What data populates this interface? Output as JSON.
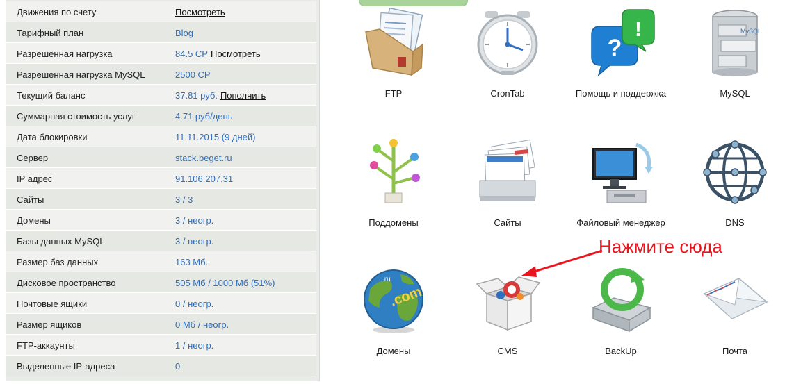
{
  "account": {
    "rows": [
      {
        "label": "Движения по счету",
        "value": "",
        "link": "Посмотреть"
      },
      {
        "label": "Тарифный план",
        "value": "Blog",
        "value_underlined": true,
        "link": ""
      },
      {
        "label": "Разрешенная нагрузка",
        "value": "84.5 CP",
        "link": "Посмотреть"
      },
      {
        "label": "Разрешенная нагрузка MySQL",
        "value": "2500 CP",
        "link": ""
      },
      {
        "label": "Текущий баланс",
        "value": "37.81 руб.",
        "link": "Пополнить"
      },
      {
        "label": "Суммарная стоимость услуг",
        "value": "4.71 руб/день",
        "link": ""
      },
      {
        "label": "Дата блокировки",
        "value": "11.11.2015 (9 дней)",
        "link": ""
      },
      {
        "label": "Сервер",
        "value": "stack.beget.ru",
        "link": ""
      },
      {
        "label": "IP адрес",
        "value": "91.106.207.31",
        "link": ""
      },
      {
        "label": "Сайты",
        "value": "3 / 3",
        "link": ""
      },
      {
        "label": "Домены",
        "value": "3 / неогр.",
        "link": ""
      },
      {
        "label": "Базы данных MySQL",
        "value": "3 / неогр.",
        "link": ""
      },
      {
        "label": "Размер баз данных",
        "value": "163 Мб.",
        "link": ""
      },
      {
        "label": "Дисковое пространство",
        "value": "505 Мб / 1000 Мб (51%)",
        "link": ""
      },
      {
        "label": "Почтовые ящики",
        "value": "0 / неогр.",
        "link": ""
      },
      {
        "label": "Размер ящиков",
        "value": "0 Мб / неогр.",
        "link": ""
      },
      {
        "label": "FTP-аккаунты",
        "value": "1 / неогр.",
        "link": ""
      },
      {
        "label": "Выделенные IP-адреса",
        "value": "0",
        "link": ""
      }
    ]
  },
  "tools": {
    "ftp": {
      "label": "FTP",
      "icon": "folder-documents-icon"
    },
    "crontab": {
      "label": "CronTab",
      "icon": "alarm-clock-icon"
    },
    "help": {
      "label": "Помощь и поддержка",
      "icon": "help-bubbles-icon"
    },
    "mysql": {
      "label": "MySQL",
      "icon": "database-cabinet-icon"
    },
    "subdomains": {
      "label": "Поддомены",
      "icon": "tree-branches-icon"
    },
    "sites": {
      "label": "Сайты",
      "icon": "site-cards-icon"
    },
    "filemanager": {
      "label": "Файловый менеджер",
      "icon": "monitor-computer-icon"
    },
    "dns": {
      "label": "DNS",
      "icon": "network-globe-icon"
    },
    "domains": {
      "label": "Домены",
      "icon": "earth-globe-icon"
    },
    "cms": {
      "label": "CMS",
      "icon": "open-box-icon"
    },
    "backup": {
      "label": "BackUp",
      "icon": "hard-drive-refresh-icon"
    },
    "mail": {
      "label": "Почта",
      "icon": "envelope-icon"
    }
  },
  "annotation": {
    "text": "Нажмите сюда",
    "color": "#e8141e"
  }
}
